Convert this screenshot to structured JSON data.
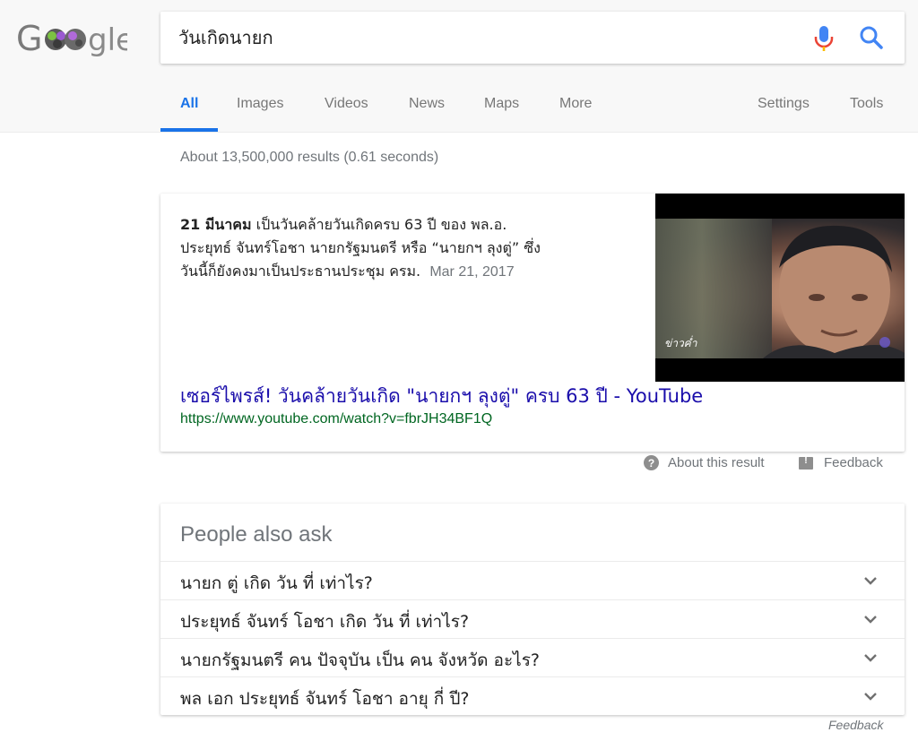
{
  "header": {
    "logo_text": "Google",
    "search": {
      "value": "วันเกิดนายก"
    },
    "icons": {
      "mic": "microphone-icon",
      "search": "search-icon"
    },
    "tabs": [
      {
        "label": "All",
        "active": true
      },
      {
        "label": "Images"
      },
      {
        "label": "Videos"
      },
      {
        "label": "News"
      },
      {
        "label": "Maps"
      },
      {
        "label": "More"
      },
      {
        "label": "Settings"
      },
      {
        "label": "Tools"
      }
    ]
  },
  "stats": "About 13,500,000 results (0.61 seconds)",
  "featured_snippet": {
    "bold_lead": "21 มีนาคม",
    "text_line1": " เป็นวันคล้ายวันเกิดครบ 63 ปี ของ พล.อ.",
    "text_line2": "ประยุทธ์ จันทร์โอชา นายกรัฐมนตรี หรือ “นายกฯ ลุงตู่” ซึ่ง",
    "text_line3": "วันนี้ก็ยังคงมาเป็นประธานประชุม ครม.",
    "date": "Mar 21, 2017",
    "thumbnail_label": "ข่าวค่ำ",
    "title": "เซอร์ไพรส์! วันคล้ายวันเกิด \"นายกฯ ลุงตู่\" ครบ 63 ปี - YouTube",
    "url": "https://www.youtube.com/watch?v=fbrJH34BF1Q"
  },
  "about_result": "About this result",
  "feedback": "Feedback",
  "people_also_ask": {
    "title": "People also ask",
    "questions": [
      "นายก ตู่ เกิด วัน ที่ เท่าไร?",
      "ประยุทธ์ จันทร์ โอชา เกิด วัน ที่ เท่าไร?",
      "นายกรัฐมนตรี คน ปัจจุบัน เป็น คน จังหวัด อะไร?",
      "พล เอก ประยุทธ์ จันทร์ โอชา อายุ กี่ ปี?"
    ]
  },
  "bottom_feedback": "Feedback",
  "colors": {
    "accent": "#1a73e8",
    "link": "#1a0dab",
    "url": "#006621"
  }
}
